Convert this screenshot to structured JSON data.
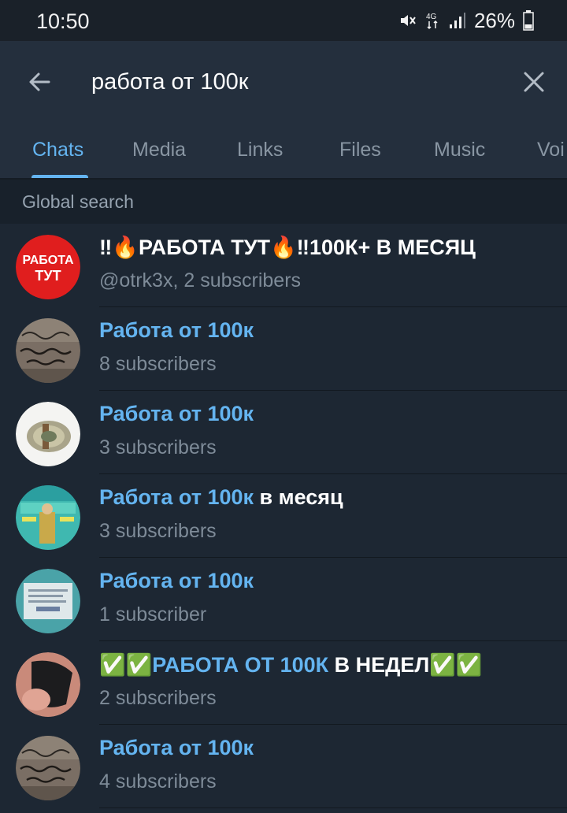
{
  "status_bar": {
    "time": "10:50",
    "battery": "26%",
    "network": "4G",
    "icons": [
      "mute-icon",
      "network-4g-icon",
      "signal-icon",
      "battery-icon"
    ]
  },
  "search": {
    "query": "работа от 100к",
    "back_icon": "arrow-left-icon",
    "clear_icon": "close-icon"
  },
  "tabs": [
    {
      "label": "Chats",
      "active": true
    },
    {
      "label": "Media"
    },
    {
      "label": "Links"
    },
    {
      "label": "Files"
    },
    {
      "label": "Music"
    },
    {
      "label": "Voi"
    }
  ],
  "section_header": "Global search",
  "results": [
    {
      "title_prefix": "‼🔥",
      "title_hl": "",
      "title_rest": "РАБОТА ТУТ🔥‼100К+ В МЕСЯЦ",
      "subtitle": "@otrk3x, 2 subscribers",
      "avatar": {
        "type": "logo",
        "text_1": "РАБОТА",
        "text_2": "ТУТ",
        "bg": "#e01e1e"
      }
    },
    {
      "title_prefix": "",
      "title_hl": "Работа от 100к",
      "title_rest": "",
      "subtitle": "8 subscribers",
      "avatar": {
        "type": "photo-graffiti"
      }
    },
    {
      "title_prefix": "",
      "title_hl": "Работа от 100к",
      "title_rest": "",
      "subtitle": "3 subscribers",
      "avatar": {
        "type": "photo-money"
      }
    },
    {
      "title_prefix": "",
      "title_hl": "Работа от 100к",
      "title_rest": " в месяц",
      "subtitle": "3 subscribers",
      "avatar": {
        "type": "photo-poster"
      }
    },
    {
      "title_prefix": "",
      "title_hl": "Работа от 100к",
      "title_rest": "",
      "subtitle": "1 subscriber",
      "avatar": {
        "type": "photo-paper"
      }
    },
    {
      "title_prefix": "✅✅",
      "title_hl": "РАБОТА ОТ 100К",
      "title_rest": " В НЕДЕЛ✅✅",
      "subtitle": "2 subscribers",
      "avatar": {
        "type": "photo-dark"
      }
    },
    {
      "title_prefix": "",
      "title_hl": "Работа от 100к",
      "title_rest": "",
      "subtitle": "4 subscribers",
      "avatar": {
        "type": "photo-graffiti"
      }
    }
  ],
  "colors": {
    "background": "#1d2733",
    "header": "#242f3d",
    "accent": "#64b4f0",
    "secondary_text": "#7e8b98"
  }
}
